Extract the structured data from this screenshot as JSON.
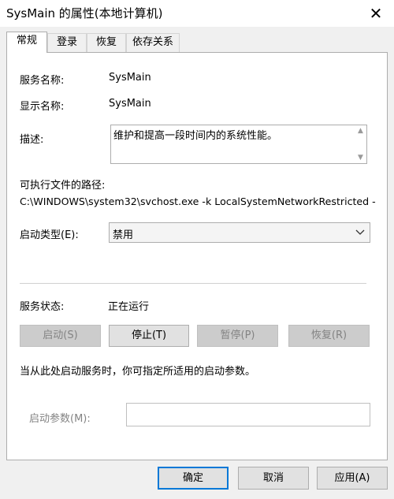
{
  "window": {
    "title": "SysMain 的属性(本地计算机)"
  },
  "tabs": [
    "常规",
    "登录",
    "恢复",
    "依存关系"
  ],
  "general": {
    "service_name_label": "服务名称:",
    "service_name": "SysMain",
    "display_name_label": "显示名称:",
    "display_name": "SysMain",
    "description_label": "描述:",
    "description": "维护和提高一段时间内的系统性能。",
    "path_label": "可执行文件的路径:",
    "path": "C:\\WINDOWS\\system32\\svchost.exe -k LocalSystemNetworkRestricted -",
    "startup_type_label": "启动类型(E):",
    "startup_type": "禁用",
    "status_label": "服务状态:",
    "status": "正在运行",
    "buttons": {
      "start": "启动(S)",
      "stop": "停止(T)",
      "pause": "暂停(P)",
      "resume": "恢复(R)"
    },
    "hint": "当从此处启动服务时，你可指定所适用的启动参数。",
    "param_label": "启动参数(M):",
    "param_value": ""
  },
  "dialog_buttons": {
    "ok": "确定",
    "cancel": "取消",
    "apply": "应用(A)"
  },
  "icons": [
    "close-icon",
    "scroll-up-icon",
    "scroll-down-icon",
    "chevron-down-icon"
  ]
}
